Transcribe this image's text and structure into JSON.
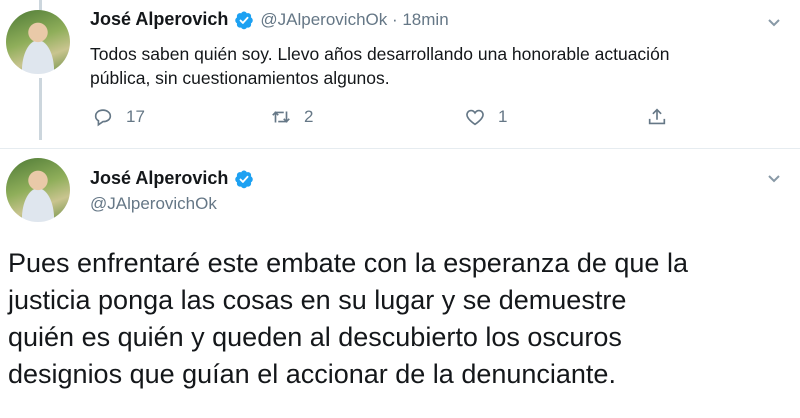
{
  "tweet1": {
    "author_name": "José Alperovich",
    "handle_time": "@JAlperovichOk · 18min",
    "text_line1": "Todos saben quién soy. Llevo años desarrollando una honorable actuación",
    "text_line2": "pública, sin cuestionamientos algunos.",
    "reply_count": "17",
    "retweet_count": "2",
    "like_count": "1"
  },
  "tweet2": {
    "author_name": "José Alperovich",
    "handle": "@JAlperovichOk",
    "lines": [
      "Pues enfrentaré este embate con la esperanza de que la",
      "justicia ponga las cosas en su lugar y se demuestre",
      "quién es quién y queden al descubierto los oscuros",
      "designios que guían el accionar de la denunciante."
    ]
  },
  "colors": {
    "verified": "#1da1f2",
    "secondary_text": "#657786",
    "thread_line": "#ccd6dd"
  },
  "icons": [
    "reply-icon",
    "retweet-icon",
    "like-icon",
    "share-icon",
    "chevron-down-icon",
    "verified-badge-icon"
  ]
}
